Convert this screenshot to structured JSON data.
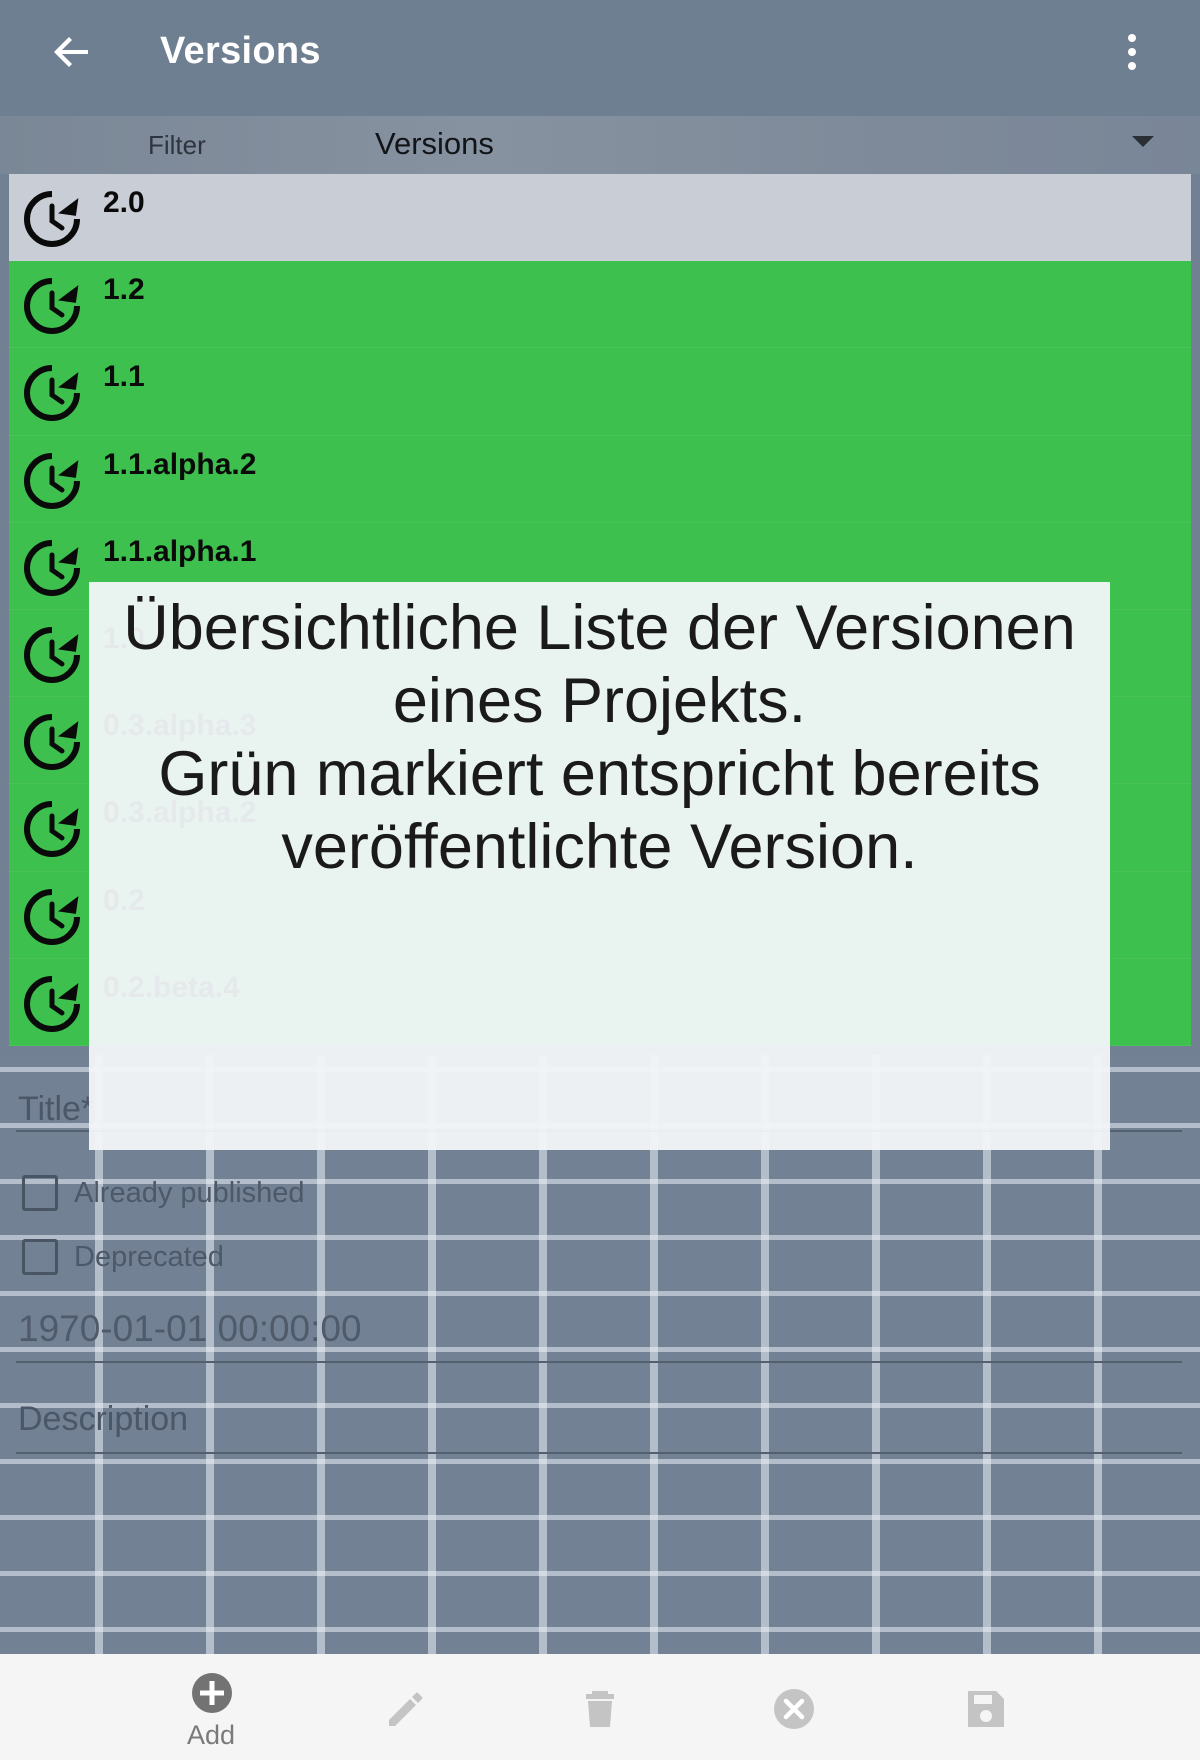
{
  "appbar": {
    "title": "Versions"
  },
  "filter": {
    "label": "Filter",
    "value": "Versions"
  },
  "versions": [
    {
      "label": "2.0",
      "status": "selected"
    },
    {
      "label": "1.2",
      "status": "published"
    },
    {
      "label": "1.1",
      "status": "published"
    },
    {
      "label": "1.1.alpha.2",
      "status": "published"
    },
    {
      "label": "1.1.alpha.1",
      "status": "published"
    },
    {
      "label": "1.0",
      "status": "published"
    },
    {
      "label": "0.3.alpha.3",
      "status": "published"
    },
    {
      "label": "0.3.alpha.2",
      "status": "published"
    },
    {
      "label": "0.2",
      "status": "published"
    },
    {
      "label": "0.2.beta.4",
      "status": "published"
    }
  ],
  "tooltip": {
    "text": "Übersichtliche Liste der Versionen eines Projekts.\nGrün markiert entspricht bereits veröffentlichte Version."
  },
  "form": {
    "title_label": "Title",
    "title_required": "*",
    "already_published_label": "Already published",
    "deprecated_label": "Deprecated",
    "date_value": "1970-01-01 00:00:00",
    "description_label": "Description"
  },
  "toolbar": {
    "add_label": "Add"
  },
  "colors": {
    "published_green": "#3ec04e",
    "selected_gray": "#c8cdd6",
    "appbar": "#6f7f92"
  }
}
